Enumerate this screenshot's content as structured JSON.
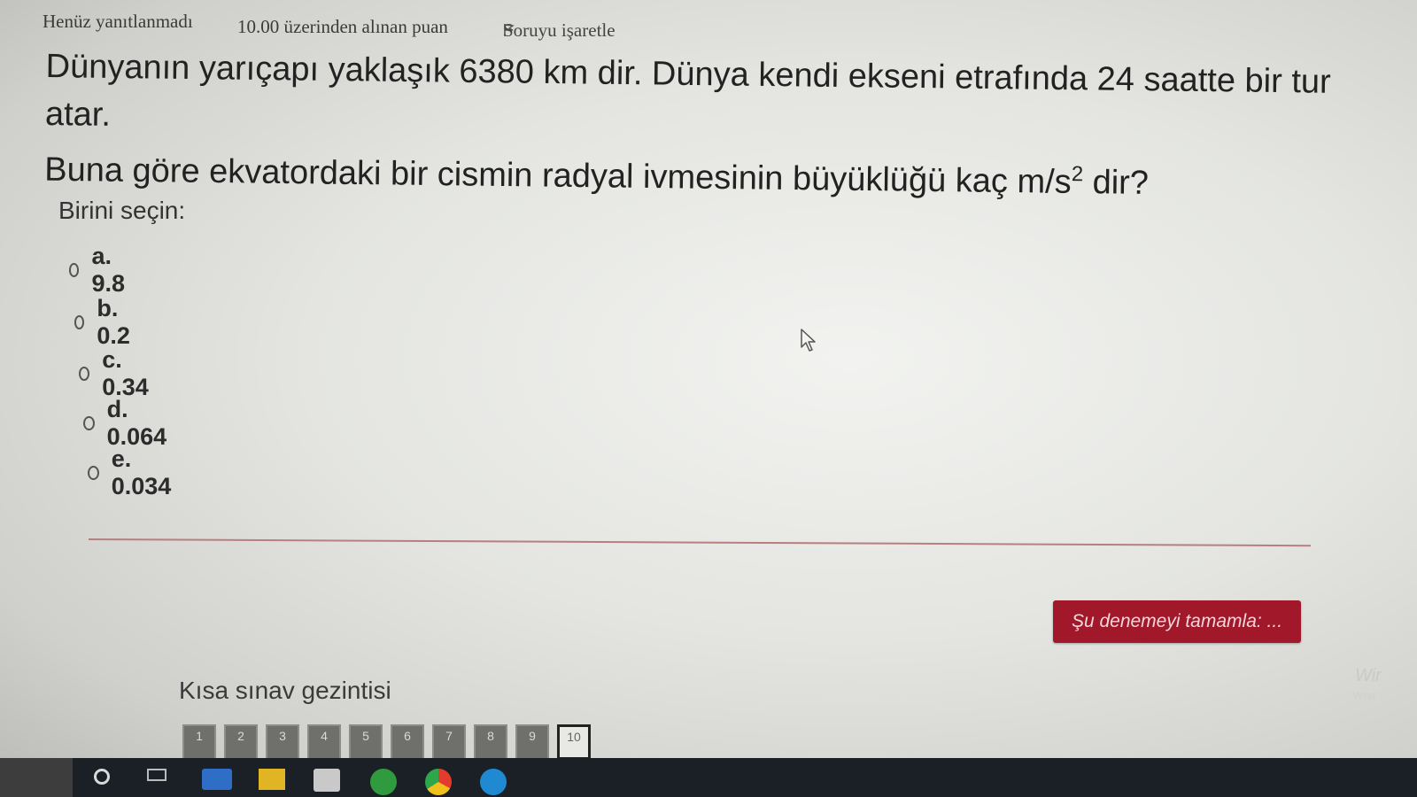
{
  "question_header": {
    "state": "Henüz yanıtlanmadı",
    "grade": "10.00 üzerinden alınan puan",
    "flag_label": "Soruyu işaretle"
  },
  "question": {
    "line1": "Dünyanın yarıçapı yaklaşık 6380 km dir. Dünya kendi ekseni etrafında 24 saatte bir tur atar.",
    "line2_pre": "Buna göre ekvatordaki bir cismin radyal ivmesinin büyüklüğü kaç m/s",
    "line2_sup": "2",
    "line2_post": " dir?"
  },
  "prompt": "Birini seçin:",
  "answers": [
    {
      "label": "a. 9.8"
    },
    {
      "label": "b. 0.2"
    },
    {
      "label": "c. 0.34"
    },
    {
      "label": "d. 0.064"
    },
    {
      "label": "e. 0.034"
    }
  ],
  "finish_button": "Şu denemeyi tamamla: ...",
  "navigation": {
    "title": "Kısa sınav gezintisi",
    "buttons": [
      "1",
      "2",
      "3",
      "4",
      "5",
      "6",
      "7",
      "8",
      "9",
      "10"
    ],
    "current": "10"
  },
  "watermark": {
    "text": "Wir",
    "sub": "Wind"
  },
  "colors": {
    "accent": "#a0182a",
    "divider": "#b77f7f",
    "taskbar": "#1b2027"
  }
}
